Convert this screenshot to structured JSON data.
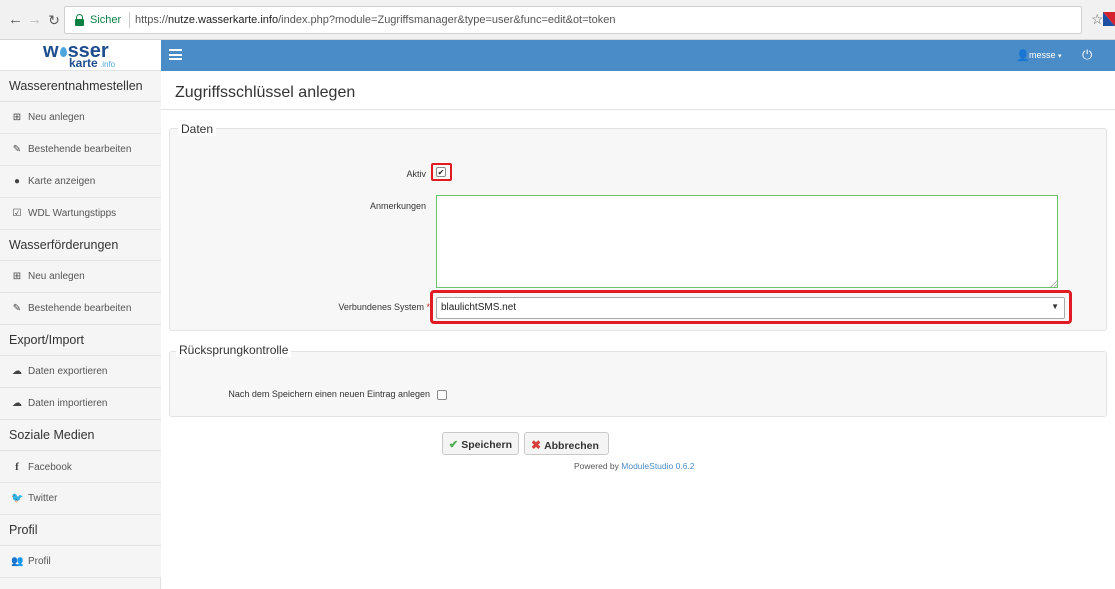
{
  "browser": {
    "secure_label": "Sicher",
    "url_prefix": "https://",
    "url_domain": "nutze.wasserkarte.info",
    "url_path": "/index.php?module=Zugriffsmanager&type=user&func=edit&ot=token"
  },
  "logo": {
    "word1": "w",
    "word2": "sser",
    "word3": "karte",
    "word4": ".info"
  },
  "sidebar": {
    "sections": [
      {
        "title": "Wasserentnahmestellen",
        "items": [
          {
            "icon": "plus-square-icon",
            "glyph": "⊞",
            "label": "Neu anlegen"
          },
          {
            "icon": "edit-icon",
            "glyph": "✎",
            "label": "Bestehende bearbeiten"
          },
          {
            "icon": "globe-icon",
            "glyph": "●",
            "label": "Karte anzeigen"
          },
          {
            "icon": "check-square-icon",
            "glyph": "☑",
            "label": "WDL Wartungstipps"
          }
        ]
      },
      {
        "title": "Wasserförderungen",
        "items": [
          {
            "icon": "plus-square-icon",
            "glyph": "⊞",
            "label": "Neu anlegen"
          },
          {
            "icon": "edit-icon",
            "glyph": "✎",
            "label": "Bestehende bearbeiten"
          }
        ]
      },
      {
        "title": "Export/Import",
        "items": [
          {
            "icon": "cloud-download-icon",
            "glyph": "☁",
            "label": "Daten exportieren"
          },
          {
            "icon": "cloud-upload-icon",
            "glyph": "☁",
            "label": "Daten importieren"
          }
        ]
      },
      {
        "title": "Soziale Medien",
        "items": [
          {
            "icon": "facebook-icon",
            "glyph": "f",
            "label": "Facebook"
          },
          {
            "icon": "twitter-icon",
            "glyph": "🐦",
            "label": "Twitter"
          }
        ]
      },
      {
        "title": "Profil",
        "items": [
          {
            "icon": "users-icon",
            "glyph": "👥",
            "label": "Profil"
          }
        ]
      }
    ]
  },
  "topnav": {
    "user": "messe",
    "accent": "#4a8cc7"
  },
  "page": {
    "title": "Zugriffsschlüssel anlegen",
    "fieldset_data": "Daten",
    "aktiv_label": "Aktiv",
    "aktiv_checked": true,
    "anmerkungen_label": "Anmerkungen",
    "anmerkungen_value": "",
    "system_label": "Verbundenes System",
    "system_required": "*",
    "system_value": "blaulichtSMS.net",
    "fieldset_back": "Rücksprungkontrolle",
    "back_label": "Nach dem Speichern einen neuen Eintrag anlegen",
    "back_checked": false
  },
  "actions": {
    "save": "Speichern",
    "cancel": "Abbrechen"
  },
  "footer": {
    "powered_by": "Powered by",
    "link": "ModuleStudio 0.6.2"
  },
  "colors": {
    "highlight": "#e01b24",
    "valid_border": "#6cc36c"
  }
}
